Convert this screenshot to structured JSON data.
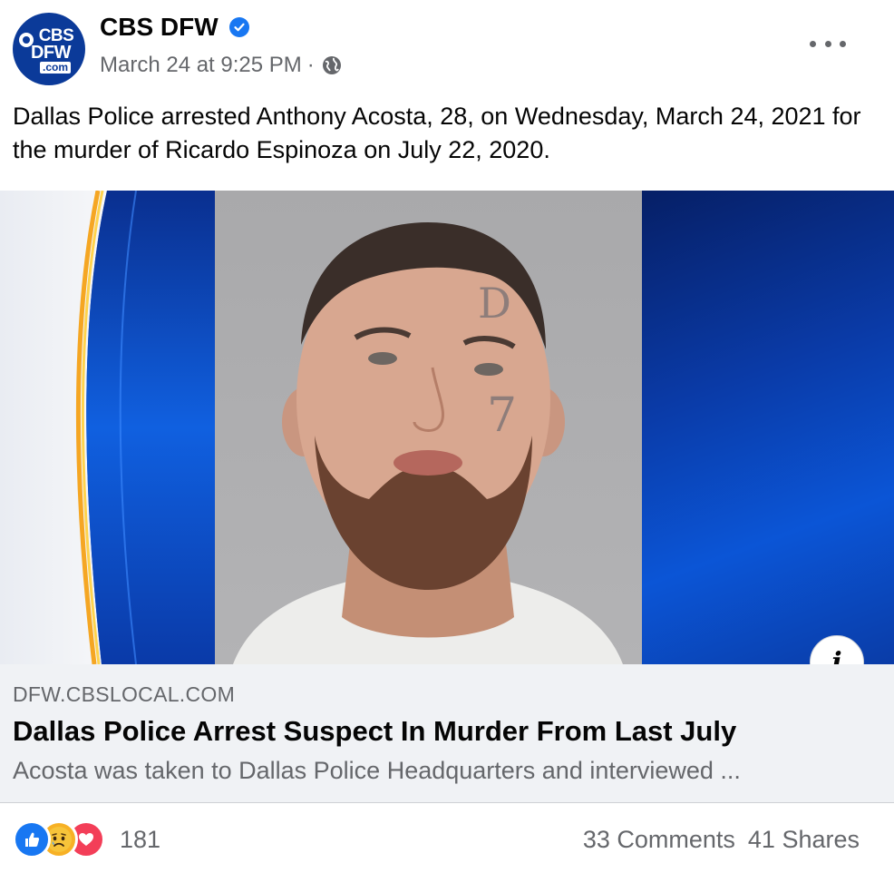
{
  "header": {
    "avatar_lines": [
      "CBS",
      "DFW",
      ".com"
    ],
    "page_name": "CBS DFW",
    "timestamp": "March 24 at 9:25 PM",
    "separator": "·",
    "verified_icon": "verified-badge-icon",
    "audience_icon": "globe-icon",
    "menu_icon": "more-options-icon"
  },
  "post": {
    "text": "Dallas Police arrested Anthony Acosta, 28, on Wednesday, March 24, 2021 for the murder of Ricardo Espinoza on July 22, 2020."
  },
  "link_preview": {
    "info_label": "i",
    "domain": "DFW.CBSLOCAL.COM",
    "title": "Dallas Police Arrest Suspect In Murder From Last July",
    "description": "Acosta was taken to Dallas Police Headquarters and interviewed ..."
  },
  "footer": {
    "reactions": [
      "like",
      "sad",
      "love"
    ],
    "reaction_count": "181",
    "comments": "33 Comments",
    "shares": "41 Shares"
  },
  "colors": {
    "accent": "#1877f2",
    "secondary_text": "#65676b",
    "link_box_bg": "#f0f2f5",
    "cbs_blue": "#0b3a99"
  }
}
